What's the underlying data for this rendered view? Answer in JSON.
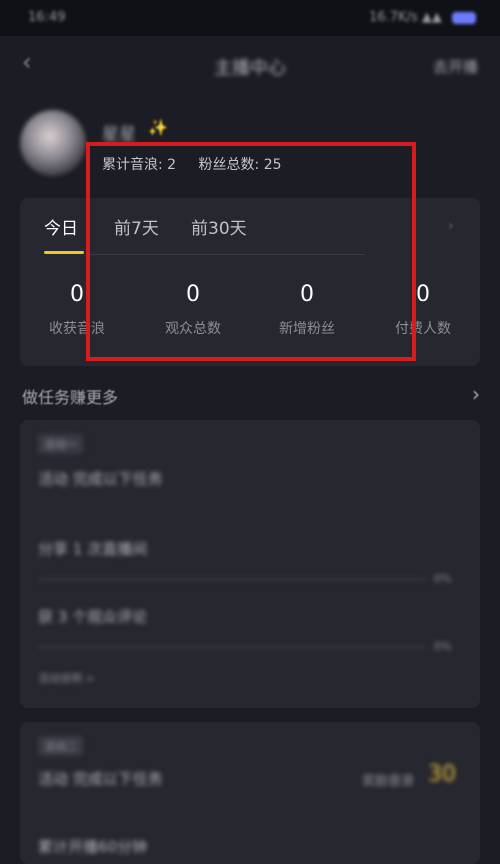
{
  "status_bar": {
    "time": "16:49",
    "right_text": "16.7K/s",
    "battery_color": "#6c7cff"
  },
  "nav": {
    "back_icon": "chevron-left-icon",
    "title": "主播中心",
    "right_action": "去开播"
  },
  "profile": {
    "name": "星星",
    "badge_icon": "sparkle-icon",
    "stats": [
      "累计音浪: 2",
      "粉丝总数: 25"
    ]
  },
  "data_card": {
    "tabs": [
      {
        "label": "今日",
        "active": true
      },
      {
        "label": "前7天",
        "active": false
      },
      {
        "label": "前30天",
        "active": false
      }
    ],
    "more_icon": "chevron-right-icon",
    "metrics": [
      {
        "value": "0",
        "label": "收获音浪"
      },
      {
        "value": "0",
        "label": "观众总数"
      },
      {
        "value": "0",
        "label": "新增粉丝"
      },
      {
        "value": "0",
        "label": "付费人数"
      }
    ],
    "accent_color": "#f3c623"
  },
  "highlight": {
    "color": "#d51d1d"
  },
  "tasks": {
    "header": "做任务赚更多",
    "panel1": {
      "tag": "活动一",
      "heading": "活动 完成以下任务",
      "items": [
        {
          "label": "分享 1 次直播间",
          "percent": "0%"
        },
        {
          "label": "获 3 个观众评论",
          "percent": "0%"
        }
      ],
      "footer": "活动说明 >"
    },
    "panel2": {
      "tag": "活动二",
      "heading": "活动 完成以下任务",
      "reward_label": "奖励音浪",
      "reward_value": "30",
      "item": "累计开播60分钟"
    }
  }
}
